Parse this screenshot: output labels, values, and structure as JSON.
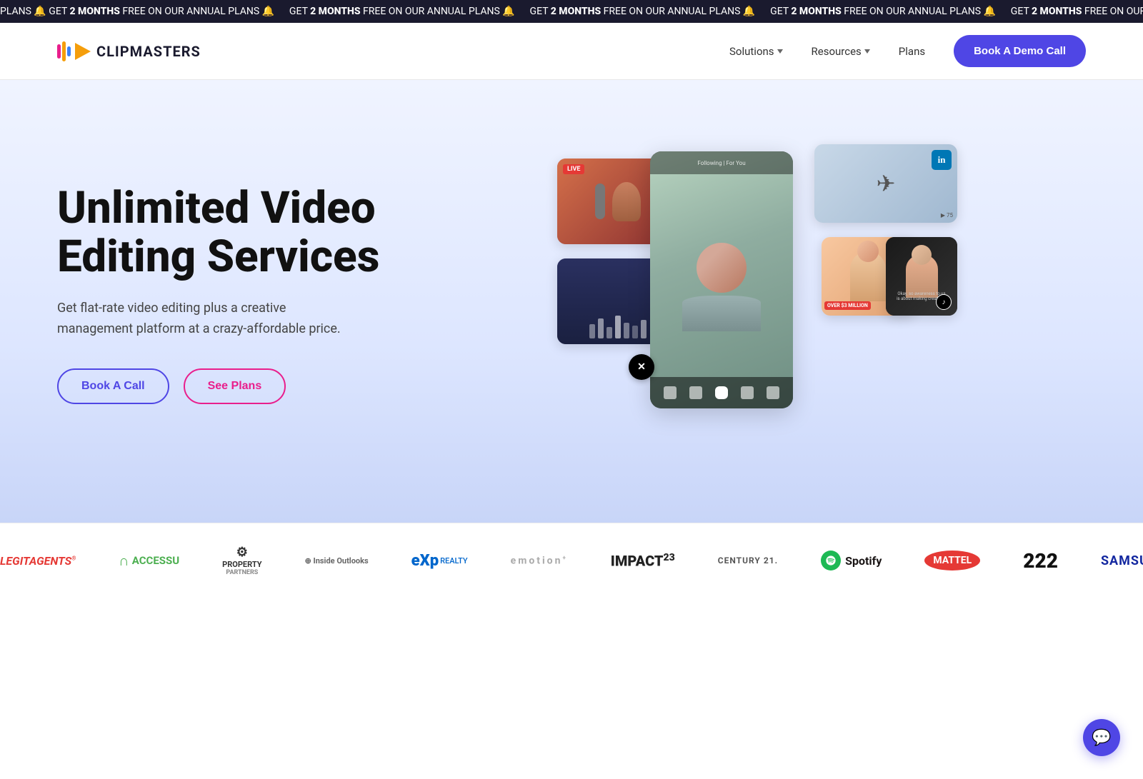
{
  "announcement": {
    "text_prefix": "PLANS 🔔 GET ",
    "highlight": "2 MONTHS",
    "text_suffix": " FREE ON OUR ANNUAL PLANS 🔔",
    "repeated": 3
  },
  "navbar": {
    "logo_text": "CLIPMASTERS",
    "nav_items": [
      {
        "label": "Solutions",
        "has_dropdown": true
      },
      {
        "label": "Resources",
        "has_dropdown": true
      },
      {
        "label": "Plans",
        "has_dropdown": false
      }
    ],
    "cta_button": "Book A Demo Call"
  },
  "hero": {
    "title_line1": "Unlimited Video",
    "title_line2": "Editing Services",
    "subtitle": "Get flat-rate video editing plus a creative management platform at a crazy-affordable price.",
    "btn_book": "Book A Call",
    "btn_plans": "See Plans"
  },
  "logos": {
    "items": [
      {
        "name": "LEGITAGENTS",
        "style": "legit"
      },
      {
        "name": "ACCESSU",
        "style": "accessu"
      },
      {
        "name": "PROPERTY",
        "style": "property"
      },
      {
        "name": "Inside Outlooks",
        "style": "inside"
      },
      {
        "name": "eXp",
        "style": "exp"
      },
      {
        "name": "emotion*",
        "style": "emotion"
      },
      {
        "name": "IMPACT23",
        "style": "impact"
      },
      {
        "name": "CENTURY 21.",
        "style": "century"
      },
      {
        "name": "Spotify",
        "style": "spotify"
      },
      {
        "name": "MATTEL",
        "style": "mattel"
      },
      {
        "name": "222",
        "style": "two22"
      },
      {
        "name": "SAMSUNG",
        "style": "samsung"
      }
    ]
  },
  "chat": {
    "icon": "💬"
  }
}
